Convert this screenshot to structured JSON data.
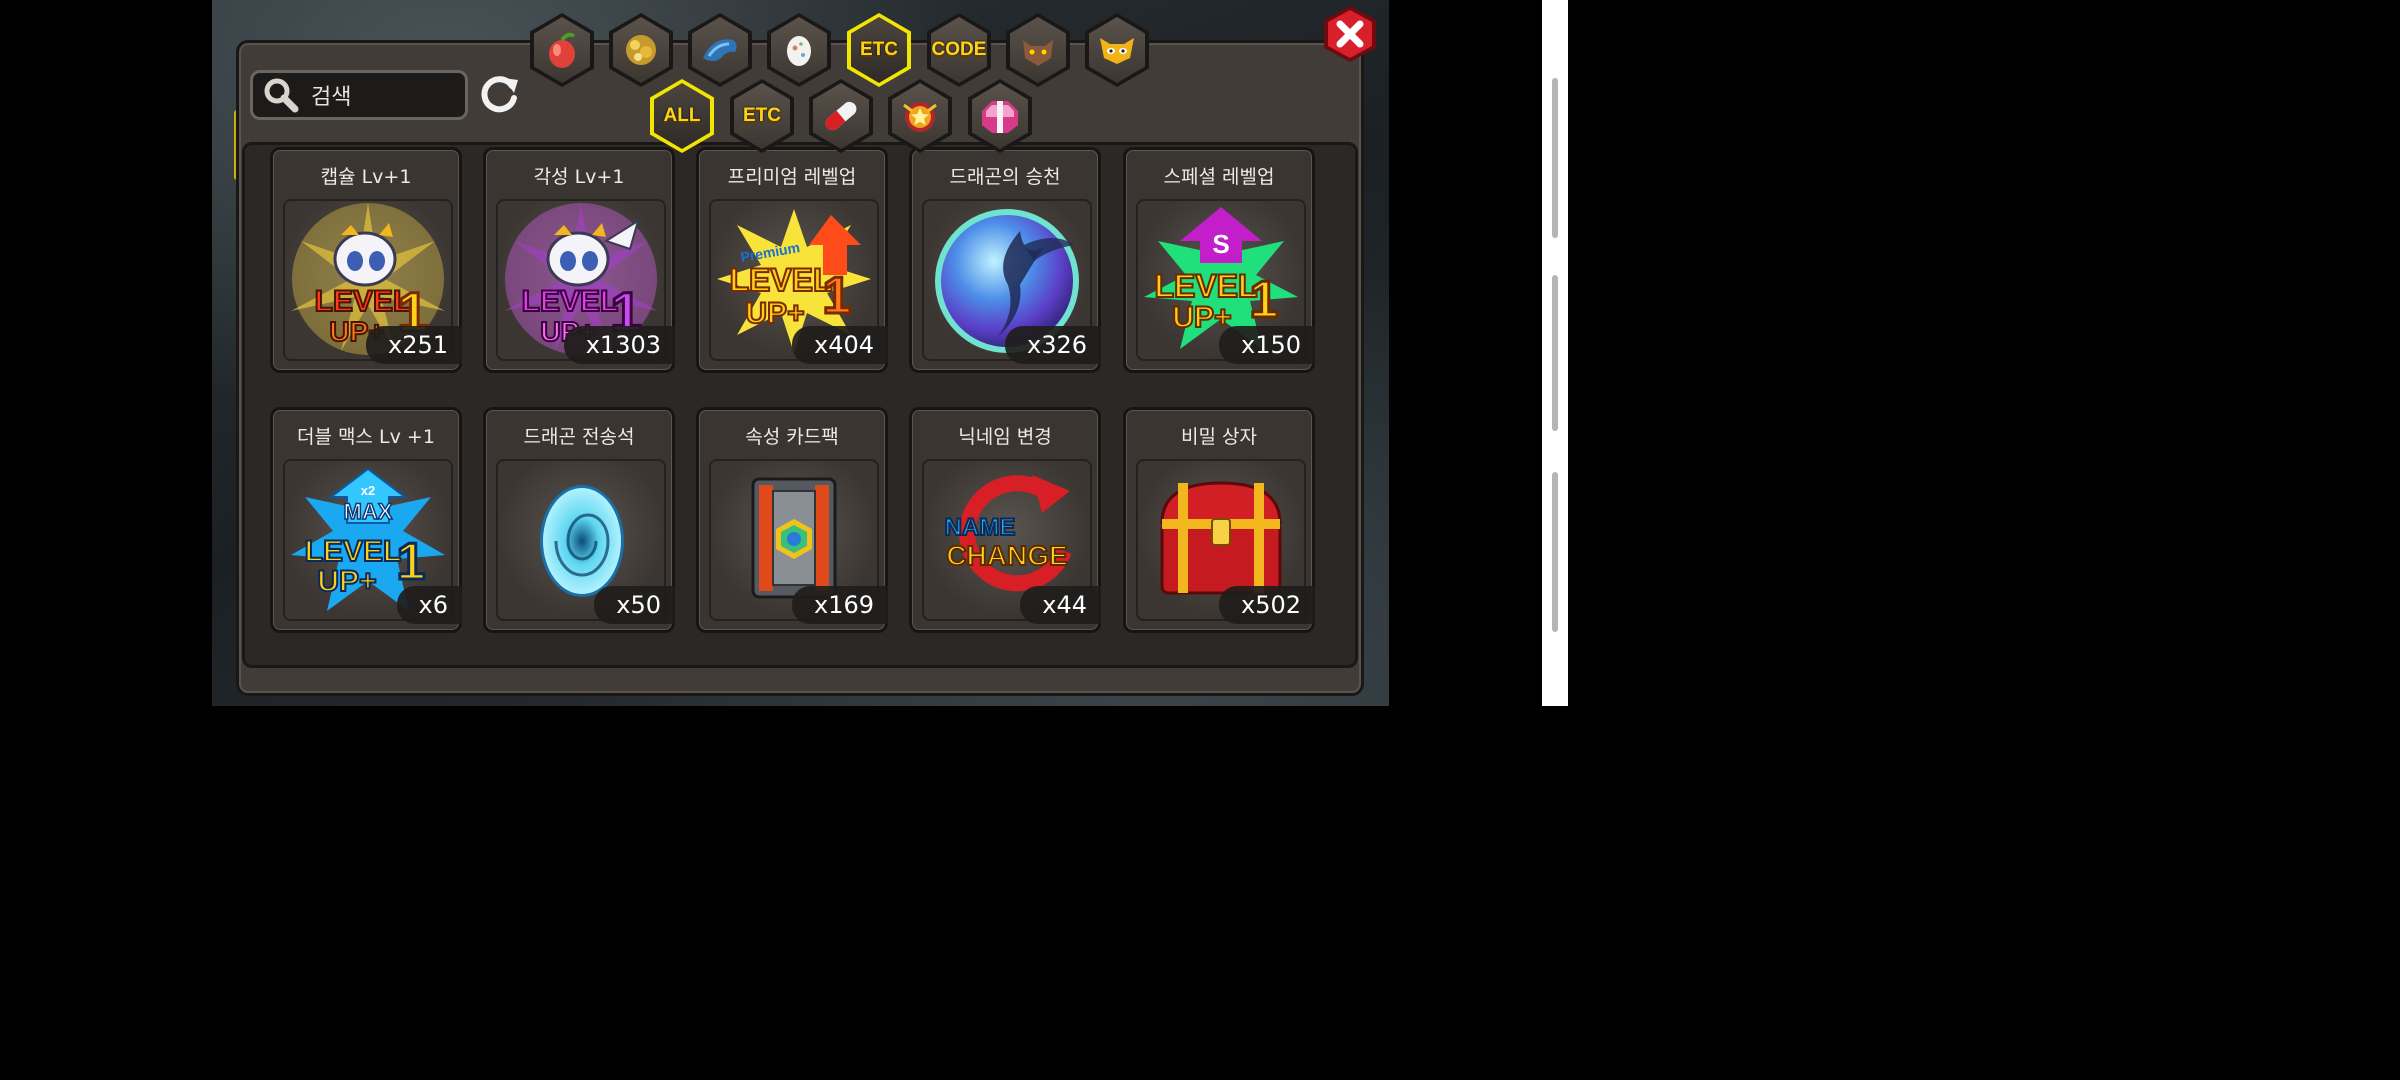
{
  "search": {
    "label": "검색"
  },
  "category_tabs": [
    {
      "name": "fruit",
      "text": ""
    },
    {
      "name": "gold",
      "text": ""
    },
    {
      "name": "dragon",
      "text": ""
    },
    {
      "name": "egg",
      "text": ""
    },
    {
      "name": "etc",
      "text": "ETC",
      "active": true
    },
    {
      "name": "code",
      "text": "CODE"
    },
    {
      "name": "wolf",
      "text": ""
    },
    {
      "name": "mask",
      "text": ""
    }
  ],
  "sub_tabs": [
    {
      "name": "all",
      "text": "ALL",
      "active": true
    },
    {
      "name": "etc",
      "text": "ETC"
    },
    {
      "name": "pill",
      "text": ""
    },
    {
      "name": "star-badge",
      "text": ""
    },
    {
      "name": "gift",
      "text": ""
    }
  ],
  "items": [
    {
      "title": "캡슐 Lv+1",
      "count": "x251",
      "icon": "level-up-gold-icon",
      "level_text": [
        "LEVEL",
        "UP+1"
      ]
    },
    {
      "title": "각성 Lv+1",
      "count": "x1303",
      "icon": "level-up-purple-icon",
      "level_text": [
        "LEVEL",
        "UP+1"
      ]
    },
    {
      "title": "프리미엄 레벨업",
      "count": "x404",
      "icon": "premium-level-up-icon",
      "level_text": [
        "Premium",
        "LEVEL",
        "UP+1"
      ]
    },
    {
      "title": "드래곤의 승천",
      "count": "x326",
      "icon": "dragon-ascension-orb-icon"
    },
    {
      "title": "스페셜 레벨업",
      "count": "x150",
      "icon": "special-level-up-icon",
      "level_text": [
        "S",
        "LEVEL",
        "UP+1"
      ]
    },
    {
      "title": "더블 맥스 Lv +1",
      "count": "x6",
      "icon": "double-max-level-up-icon",
      "level_text": [
        "x2",
        "MAX",
        "LEVEL",
        "UP+1"
      ]
    },
    {
      "title": "드래곤 전송석",
      "count": "x50",
      "icon": "dragon-transfer-stone-icon"
    },
    {
      "title": "속성 카드팩",
      "count": "x169",
      "icon": "attribute-card-pack-icon"
    },
    {
      "title": "닉네임 변경",
      "count": "x44",
      "icon": "name-change-icon",
      "level_text": [
        "NAME",
        "CHANGE"
      ]
    },
    {
      "title": "비밀 상자",
      "count": "x502",
      "icon": "secret-chest-icon"
    }
  ],
  "colors": {
    "accent_yellow": "#f2e600",
    "close_red": "#d8202a",
    "panel": "#413c38"
  }
}
